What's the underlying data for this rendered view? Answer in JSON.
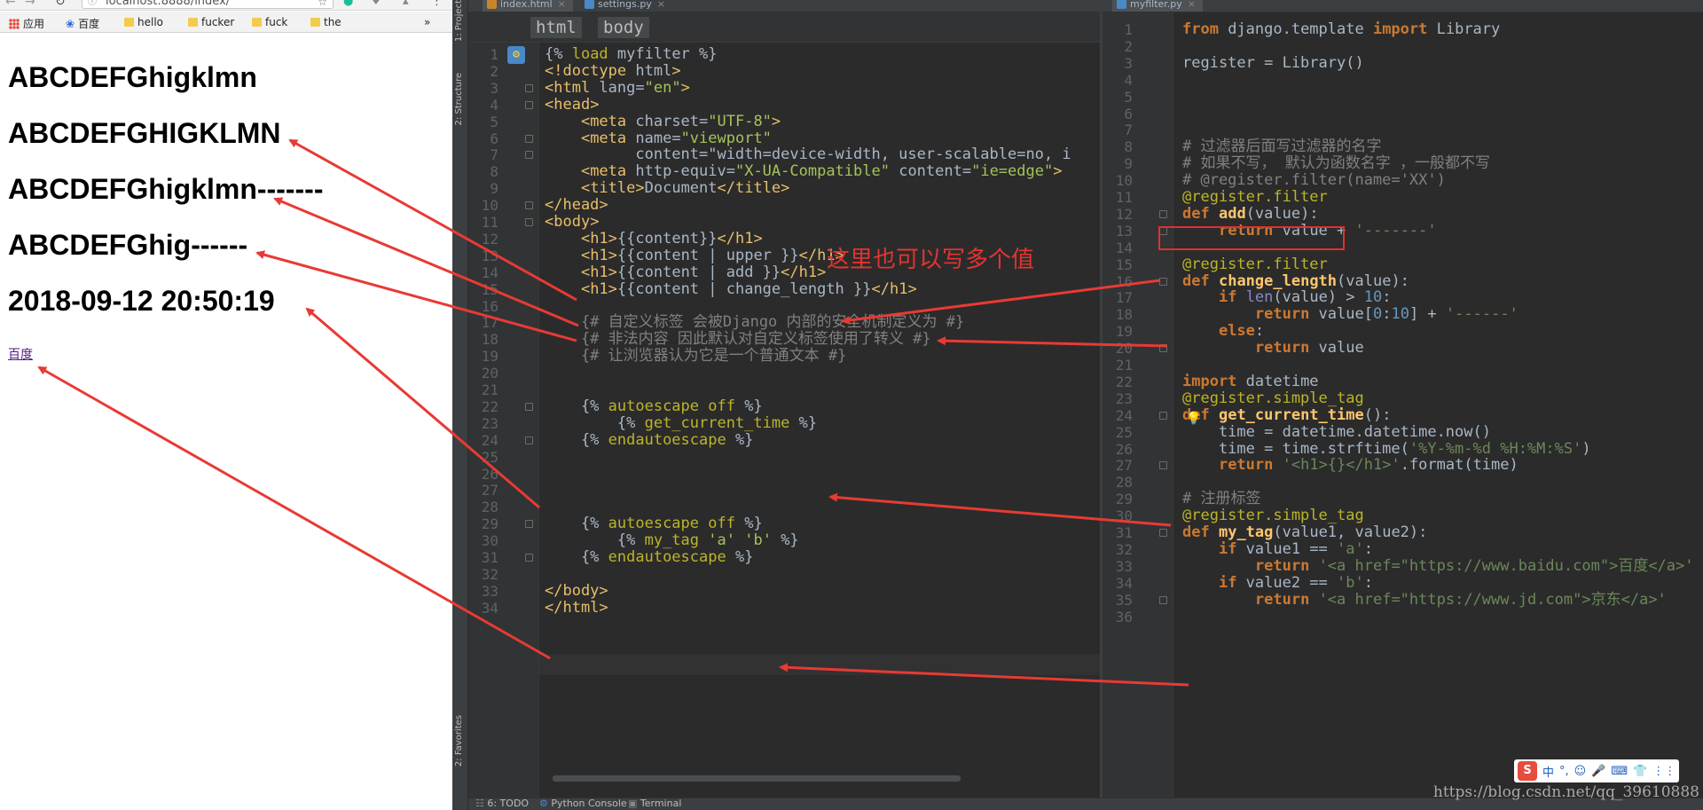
{
  "browser": {
    "url": "localhost:8888/index/",
    "bookmarks": [
      "应用",
      "百度",
      "hello",
      "fucker",
      "fuck",
      "the"
    ],
    "more": "»",
    "headings": [
      "ABCDEFGhigklmn",
      "ABCDEFGHIGKLMN",
      "ABCDEFGhigklmn-------",
      "ABCDEFGhig------",
      "2018-09-12 20:50:19"
    ],
    "link": "百度"
  },
  "ide": {
    "sidebar_labels": [
      "1: Project",
      "2: Structure",
      "2: Favorites"
    ],
    "left_tabs": [
      "index.html",
      "settings.py"
    ],
    "right_tab": "myfilter.py",
    "breadcrumbs": [
      "html",
      "body"
    ],
    "left_lines": [
      "{% load myfilter %}",
      "<!doctype html>",
      "<html lang=\"en\">",
      "<head>",
      "    <meta charset=\"UTF-8\">",
      "    <meta name=\"viewport\"",
      "          content=\"width=device-width, user-scalable=no, i",
      "    <meta http-equiv=\"X-UA-Compatible\" content=\"ie=edge\">",
      "    <title>Document</title>",
      "</head>",
      "<body>",
      "    <h1>{{content}}</h1>",
      "    <h1>{{content | upper }}</h1>",
      "    <h1>{{content | add }}</h1>",
      "    <h1>{{content | change_length }}</h1>",
      "",
      "    {# 自定义标签 会被Django 内部的安全机制定义为 #}",
      "    {# 非法内容 因此默认对自定义标签使用了转义 #}",
      "    {# 让浏览器认为它是一个普通文本 #}",
      "",
      "",
      "    {% autoescape off %}",
      "        {% get_current_time %}",
      "    {% endautoescape %}",
      "",
      "",
      "",
      "",
      "    {% autoescape off %}",
      "        {% my_tag 'a' 'b' %}",
      "    {% endautoescape %}",
      "",
      "</body>",
      "</html>"
    ],
    "right_lines": [
      "from django.template import Library",
      "",
      "register = Library()",
      "",
      "",
      "",
      "",
      "# 过滤器后面写过滤器的名字",
      "# 如果不写， 默认为函数名字 ，一般都不写",
      "# @register.filter(name='XX')",
      "@register.filter",
      "def add(value):",
      "    return value + '-------'",
      "",
      "@register.filter",
      "def change_length(value):",
      "    if len(value) > 10:",
      "        return value[0:10] + '------'",
      "    else:",
      "        return value",
      "",
      "import datetime",
      "@register.simple_tag",
      "def get_current_time():",
      "    time = datetime.datetime.now()",
      "    time = time.strftime('%Y-%m-%d %H:%M:%S')",
      "    return '<h1>{}</h1>'.format(time)",
      "",
      "# 注册标签",
      "@register.simple_tag",
      "def my_tag(value1, value2):",
      "    if value1 == 'a':",
      "        return '<a href=\"https://www.baidu.com\">百度</a>'",
      "    if value2 == 'b':",
      "        return '<a href=\"https://www.jd.com\">京东</a>'",
      ""
    ],
    "bottom_tools": [
      "6: TODO",
      "Python Console",
      "Terminal"
    ]
  },
  "annotation": "这里也可以写多个值",
  "ime_bar": [
    "中",
    "°,",
    "☺",
    "🎤",
    "⌨",
    "👕",
    "⋮⋮"
  ],
  "watermark": "https://blog.csdn.net/qq_39610888"
}
